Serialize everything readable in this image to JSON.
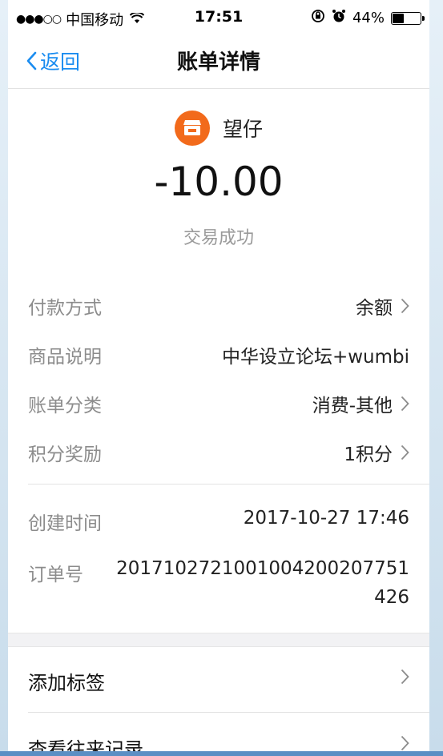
{
  "status_bar": {
    "signal": "●●●○○",
    "carrier": "中国移动",
    "time": "17:51",
    "battery": "44%",
    "battery_level": 0.44,
    "icons": [
      "wifi-icon",
      "orientation-lock-icon",
      "alarm-icon",
      "battery-icon"
    ]
  },
  "nav": {
    "back_label": "返回",
    "title": "账单详情"
  },
  "merchant": {
    "name": "望仔",
    "icon": "shop-icon",
    "icon_color": "#f26a1b"
  },
  "transaction": {
    "amount": "-10.00",
    "status": "交易成功"
  },
  "details": [
    {
      "label": "付款方式",
      "value": "余额",
      "has_arrow": true
    },
    {
      "label": "商品说明",
      "value": "中华设立论坛+wumbi",
      "has_arrow": false
    },
    {
      "label": "账单分类",
      "value": "消费-其他",
      "has_arrow": true
    },
    {
      "label": "积分奖励",
      "value": "1积分",
      "has_arrow": true
    }
  ],
  "meta": {
    "created_label": "创建时间",
    "created_value": "2017-10-27 17:46",
    "order_label": "订单号",
    "order_value": "2017102721001004200207751426"
  },
  "actions": [
    {
      "label": "添加标签"
    },
    {
      "label": "查看往来记录"
    }
  ],
  "colors": {
    "accent": "#1a8cf0",
    "label": "#8c8c8c",
    "divider": "#e3e3e3"
  }
}
